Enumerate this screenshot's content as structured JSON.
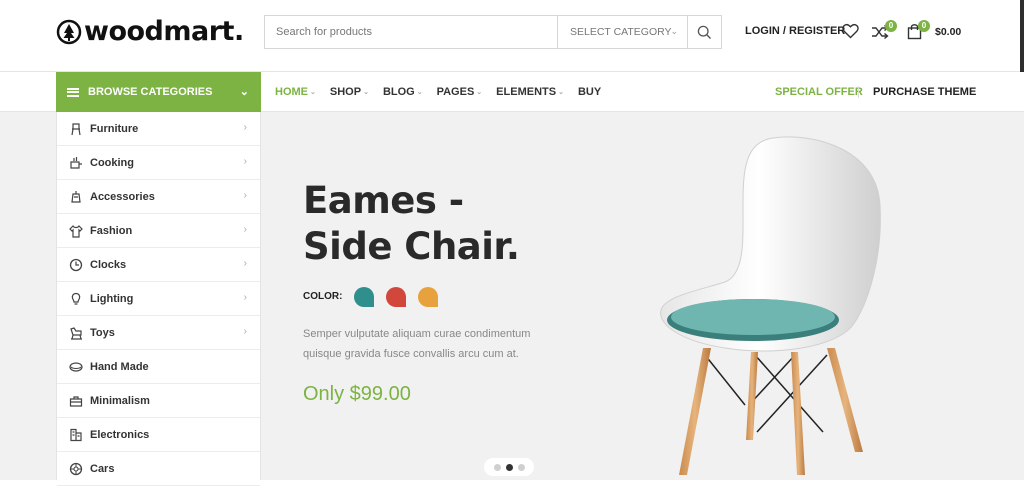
{
  "header": {
    "logo_text": "woodmart.",
    "search": {
      "placeholder": "Search for products",
      "category": "SELECT CATEGORY"
    },
    "account": "LOGIN / REGISTER",
    "compare_count": "0",
    "cart_count": "0",
    "cart_total": "$0.00"
  },
  "nav": {
    "browse": "BROWSE CATEGORIES",
    "items": [
      {
        "label": "HOME",
        "active": true,
        "dropdown": true
      },
      {
        "label": "SHOP",
        "active": false,
        "dropdown": true
      },
      {
        "label": "BLOG",
        "active": false,
        "dropdown": true
      },
      {
        "label": "PAGES",
        "active": false,
        "dropdown": true
      },
      {
        "label": "ELEMENTS",
        "active": false,
        "dropdown": true
      },
      {
        "label": "BUY",
        "active": false,
        "dropdown": false
      }
    ],
    "special_offer": "SPECIAL OFFER",
    "purchase_theme": "PURCHASE THEME"
  },
  "categories": [
    {
      "label": "Furniture",
      "icon": "chair-icon",
      "submenu": true
    },
    {
      "label": "Cooking",
      "icon": "cooking-icon",
      "submenu": true
    },
    {
      "label": "Accessories",
      "icon": "accessories-icon",
      "submenu": true
    },
    {
      "label": "Fashion",
      "icon": "shirt-icon",
      "submenu": true
    },
    {
      "label": "Clocks",
      "icon": "clock-icon",
      "submenu": true
    },
    {
      "label": "Lighting",
      "icon": "bulb-icon",
      "submenu": true
    },
    {
      "label": "Toys",
      "icon": "toy-horse-icon",
      "submenu": true
    },
    {
      "label": "Hand Made",
      "icon": "handmade-icon",
      "submenu": false
    },
    {
      "label": "Minimalism",
      "icon": "case-icon",
      "submenu": false
    },
    {
      "label": "Electronics",
      "icon": "electronics-icon",
      "submenu": false
    },
    {
      "label": "Cars",
      "icon": "car-wheel-icon",
      "submenu": false
    }
  ],
  "hero": {
    "title_line1": "Eames -",
    "title_line2": "Side Chair.",
    "color_label": "COLOR:",
    "swatches": [
      "#2e8f8c",
      "#d2473c",
      "#e8a23d"
    ],
    "description": "Semper vulputate aliquam curae condimentum quisque gravida fusce convallis arcu cum at.",
    "price": "Only $99.00",
    "slides": 3,
    "active_slide": 2
  },
  "colors": {
    "accent": "#7cb342",
    "text_dark": "#222222",
    "hero_bg": "#f1f1f1"
  }
}
